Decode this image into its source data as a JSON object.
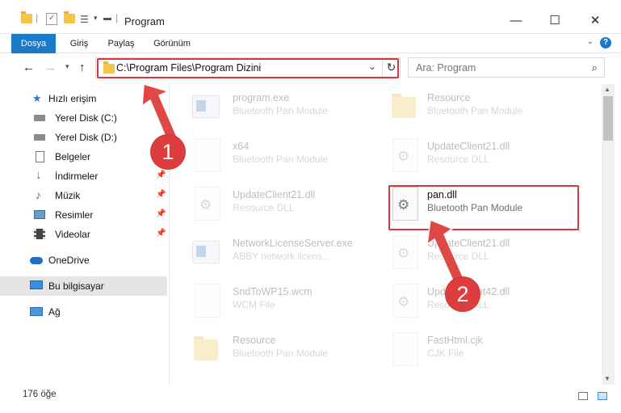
{
  "window": {
    "title": "Program",
    "minimize_icon": "minimize-icon",
    "maximize_icon": "maximize-icon",
    "close_icon": "close-icon"
  },
  "ribbon": {
    "tabs": [
      {
        "label": "Dosya"
      },
      {
        "label": "Giriş"
      },
      {
        "label": "Paylaş"
      },
      {
        "label": "Görünüm"
      }
    ],
    "help": "?"
  },
  "navigation": {
    "address": "C:\\Program Files\\Program Dizini",
    "search_placeholder": "Ara: Program"
  },
  "sidebar": {
    "items": [
      {
        "label": "Hızlı erişim",
        "icon": "star-icon"
      },
      {
        "label": "Yerel Disk (C:)",
        "icon": "drive-icon"
      },
      {
        "label": "Yerel Disk (D:)",
        "icon": "drive-icon"
      },
      {
        "label": "Belgeler",
        "icon": "documents-icon"
      },
      {
        "label": "İndirmeler",
        "icon": "download-icon"
      },
      {
        "label": "Müzik",
        "icon": "music-icon"
      },
      {
        "label": "Resimler",
        "icon": "pictures-icon"
      },
      {
        "label": "Videolar",
        "icon": "videos-icon"
      },
      {
        "label": "OneDrive",
        "icon": "cloud-icon"
      },
      {
        "label": "Bu bilgisayar",
        "icon": "computer-icon"
      },
      {
        "label": "Ağ",
        "icon": "network-icon"
      }
    ]
  },
  "files": [
    {
      "name": "program.exe",
      "desc": "Bluetooth Pan Module"
    },
    {
      "name": "Resource",
      "desc": "Bluetooth Pan Module"
    },
    {
      "name": "x64",
      "desc": "Bluetooth Pan Module"
    },
    {
      "name": "UpdateClient21.dll",
      "desc": "Resource DLL"
    },
    {
      "name": "UpdateClient21.dll",
      "desc": "Resource DLL"
    },
    {
      "name": "pan.dll",
      "desc": "Bluetooth Pan Module"
    },
    {
      "name": "NetworkLicenseServer.exe",
      "desc": "ABBY network licens..."
    },
    {
      "name": "UpdateClient21.dll",
      "desc": "Resource DLL"
    },
    {
      "name": "SndToWP15.wcm",
      "desc": "WCM File"
    },
    {
      "name": "UpdateClient42.dll",
      "desc": "Resource DLL"
    },
    {
      "name": "Resource",
      "desc": "Bluetooth Pan Module"
    },
    {
      "name": "FastHtml.cjk",
      "desc": "CJK File"
    }
  ],
  "status": {
    "count": "176 öğe"
  },
  "callouts": [
    "1",
    "2"
  ],
  "colors": {
    "accent": "#1979ca",
    "highlight": "#d9383a",
    "callout": "#dd3d3d"
  }
}
